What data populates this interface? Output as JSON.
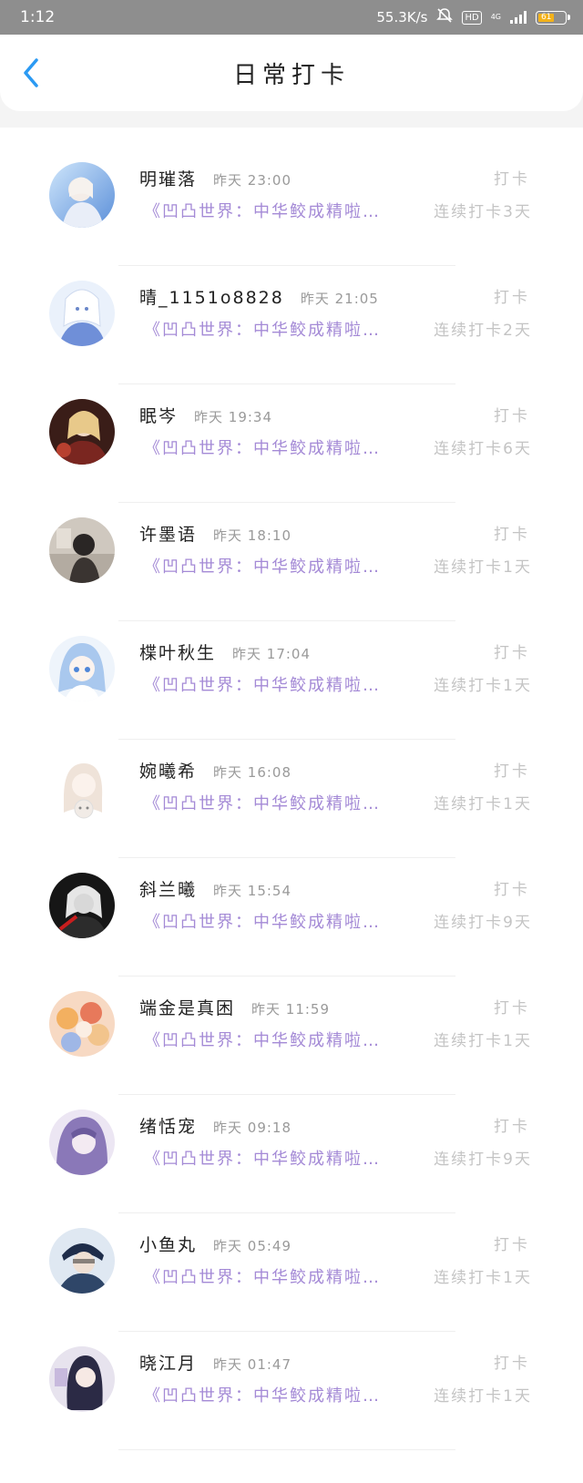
{
  "status_bar": {
    "time": "1:12",
    "speed": "55.3K/s",
    "hd": "HD",
    "network": "4G",
    "battery": "61"
  },
  "header": {
    "title": "日常打卡"
  },
  "checkins": [
    {
      "name": "明璀落",
      "time": "昨天 23:00",
      "action": "打卡",
      "book": "《凹凸世界：中华鲛成精啦…",
      "streak": "连续打卡3天"
    },
    {
      "name": "晴_1151o8828",
      "time": "昨天 21:05",
      "action": "打卡",
      "book": "《凹凸世界：中华鲛成精啦…",
      "streak": "连续打卡2天"
    },
    {
      "name": "眠岑",
      "time": "昨天 19:34",
      "action": "打卡",
      "book": "《凹凸世界：中华鲛成精啦…",
      "streak": "连续打卡6天"
    },
    {
      "name": "许墨语",
      "time": "昨天 18:10",
      "action": "打卡",
      "book": "《凹凸世界：中华鲛成精啦…",
      "streak": "连续打卡1天"
    },
    {
      "name": "楪叶秋生",
      "time": "昨天 17:04",
      "action": "打卡",
      "book": "《凹凸世界：中华鲛成精啦…",
      "streak": "连续打卡1天"
    },
    {
      "name": "婉曦希",
      "time": "昨天 16:08",
      "action": "打卡",
      "book": "《凹凸世界：中华鲛成精啦…",
      "streak": "连续打卡1天"
    },
    {
      "name": "斜兰曦",
      "time": "昨天 15:54",
      "action": "打卡",
      "book": "《凹凸世界：中华鲛成精啦…",
      "streak": "连续打卡9天"
    },
    {
      "name": "端金是真困",
      "time": "昨天 11:59",
      "action": "打卡",
      "book": "《凹凸世界：中华鲛成精啦…",
      "streak": "连续打卡1天"
    },
    {
      "name": "绪恬宠",
      "time": "昨天 09:18",
      "action": "打卡",
      "book": "《凹凸世界：中华鲛成精啦…",
      "streak": "连续打卡9天"
    },
    {
      "name": "小鱼丸",
      "time": "昨天 05:49",
      "action": "打卡",
      "book": "《凹凸世界：中华鲛成精啦…",
      "streak": "连续打卡1天"
    },
    {
      "name": "晓江月",
      "time": "昨天 01:47",
      "action": "打卡",
      "book": "《凹凸世界：中华鲛成精啦…",
      "streak": "连续打卡1天"
    }
  ],
  "colors": {
    "accent": "#2b9af3",
    "book_text": "#a48ad6",
    "muted": "#c4c4c4",
    "status_bar": "#8e8e8e"
  },
  "icons": {
    "back": "chevron-left-icon",
    "mute": "bell-off-icon",
    "signal": "signal-icon",
    "battery": "battery-icon"
  }
}
